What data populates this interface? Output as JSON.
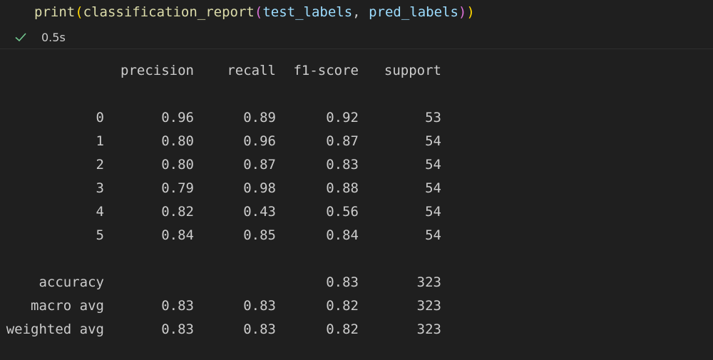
{
  "code": {
    "fn": "print",
    "inner_fn": "classification_report",
    "arg1": "test_labels",
    "sep": ", ",
    "arg2": "pred_labels"
  },
  "status": {
    "icon": "check-icon",
    "success_color": "#73c991",
    "duration": "0.5s"
  },
  "report": {
    "headers": [
      "precision",
      "recall",
      "f1-score",
      "support"
    ],
    "rows": [
      {
        "label": "0",
        "precision": "0.96",
        "recall": "0.89",
        "f1": "0.92",
        "support": "53"
      },
      {
        "label": "1",
        "precision": "0.80",
        "recall": "0.96",
        "f1": "0.87",
        "support": "54"
      },
      {
        "label": "2",
        "precision": "0.80",
        "recall": "0.87",
        "f1": "0.83",
        "support": "54"
      },
      {
        "label": "3",
        "precision": "0.79",
        "recall": "0.98",
        "f1": "0.88",
        "support": "54"
      },
      {
        "label": "4",
        "precision": "0.82",
        "recall": "0.43",
        "f1": "0.56",
        "support": "54"
      },
      {
        "label": "5",
        "precision": "0.84",
        "recall": "0.85",
        "f1": "0.84",
        "support": "54"
      }
    ],
    "summary": [
      {
        "label": "accuracy",
        "precision": "",
        "recall": "",
        "f1": "0.83",
        "support": "323"
      },
      {
        "label": "macro avg",
        "precision": "0.83",
        "recall": "0.83",
        "f1": "0.82",
        "support": "323"
      },
      {
        "label": "weighted avg",
        "precision": "0.83",
        "recall": "0.83",
        "f1": "0.82",
        "support": "323"
      }
    ]
  }
}
